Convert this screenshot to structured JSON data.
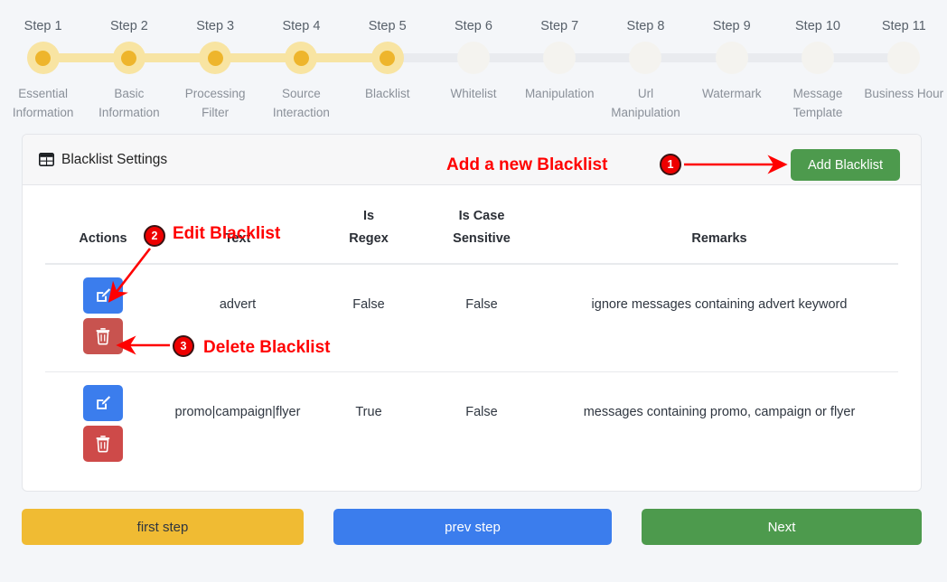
{
  "stepper": {
    "steps": [
      {
        "title": "Step 1",
        "label": "Essential Information",
        "state": "done"
      },
      {
        "title": "Step 2",
        "label": "Basic Information",
        "state": "done"
      },
      {
        "title": "Step 3",
        "label": "Processing Filter",
        "state": "done"
      },
      {
        "title": "Step 4",
        "label": "Source Interaction",
        "state": "done"
      },
      {
        "title": "Step 5",
        "label": "Blacklist",
        "state": "current"
      },
      {
        "title": "Step 6",
        "label": "Whitelist",
        "state": "todo"
      },
      {
        "title": "Step 7",
        "label": "Manipulation",
        "state": "todo"
      },
      {
        "title": "Step 8",
        "label": "Url Manipulation",
        "state": "todo"
      },
      {
        "title": "Step 9",
        "label": "Watermark",
        "state": "todo"
      },
      {
        "title": "Step 10",
        "label": "Message Template",
        "state": "todo"
      },
      {
        "title": "Step 11",
        "label": "Business Hour",
        "state": "todo"
      }
    ],
    "active_color": "#eeb52c",
    "active_halo_color": "#f8e4a2",
    "inactive_color": "#e9ebef"
  },
  "card": {
    "icon": "table-grid-icon",
    "title": "Blacklist Settings",
    "add_button_label": "Add Blacklist",
    "add_button_color": "#4d9a4d"
  },
  "table": {
    "headers": {
      "actions": "Actions",
      "text": "Text",
      "is_regex_line1": "Is",
      "is_regex_line2": "Regex",
      "is_case_line1": "Is Case",
      "is_case_line2": "Sensitive",
      "remarks": "Remarks"
    },
    "rows": [
      {
        "text": "advert",
        "is_regex": "False",
        "is_case_sensitive": "False",
        "remarks": "ignore messages containing advert keyword",
        "edit_icon": "pencil-square-icon",
        "delete_icon": "trash-icon"
      },
      {
        "text": "promo|campaign|flyer",
        "is_regex": "True",
        "is_case_sensitive": "False",
        "remarks": "messages containing promo, campaign or flyer",
        "edit_icon": "pencil-square-icon",
        "delete_icon": "trash-icon"
      }
    ]
  },
  "footer": {
    "first_step": "first step",
    "prev_step": "prev step",
    "next": "Next",
    "first_color": "#f0bb33",
    "prev_color": "#3b7ded",
    "next_color": "#4d9a4d"
  },
  "annotations": {
    "color": "#ff0000",
    "items": [
      {
        "number": "1",
        "text": "Add a new Blacklist"
      },
      {
        "number": "2",
        "text": "Edit Blacklist"
      },
      {
        "number": "3",
        "text": "Delete Blacklist"
      }
    ]
  }
}
